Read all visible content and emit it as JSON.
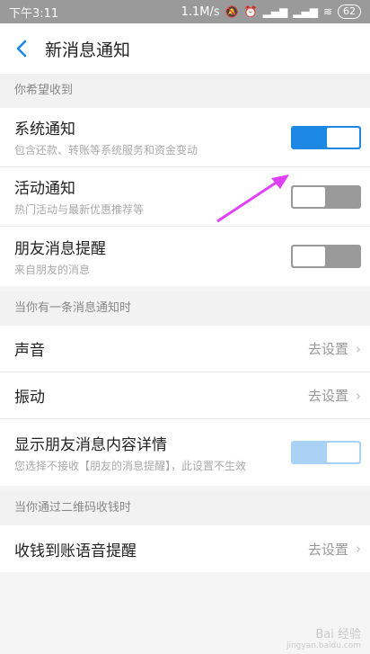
{
  "status_bar": {
    "time": "下午3:11",
    "speed": "1.1M/s",
    "battery": "62"
  },
  "header": {
    "title": "新消息通知"
  },
  "sections": {
    "s1": {
      "header": "你希望收到",
      "items": [
        {
          "title": "系统通知",
          "subtitle": "包含还款、转账等系统服务和资金变动",
          "toggle": "on"
        },
        {
          "title": "活动通知",
          "subtitle": "热门活动与最新优惠推荐等",
          "toggle": "off"
        },
        {
          "title": "朋友消息提醒",
          "subtitle": "来自朋友的消息",
          "toggle": "off"
        }
      ]
    },
    "s2": {
      "header": "当你有一条消息通知时",
      "items": [
        {
          "title": "声音",
          "value": "去设置"
        },
        {
          "title": "振动",
          "value": "去设置"
        },
        {
          "title": "显示朋友消息内容详情",
          "subtitle": "您选择不接收【朋友的消息提醒】，此设置不生效",
          "toggle": "on-disabled"
        }
      ]
    },
    "s3": {
      "header": "当你通过二维码收钱时",
      "items": [
        {
          "title": "收钱到账语音提醒",
          "value": "去设置"
        }
      ]
    }
  },
  "watermark": {
    "line1": "Bai 经验",
    "line2": "jingyan.baidu.com"
  },
  "colors": {
    "accent": "#1e88e5",
    "arrow": "#e040fb"
  }
}
